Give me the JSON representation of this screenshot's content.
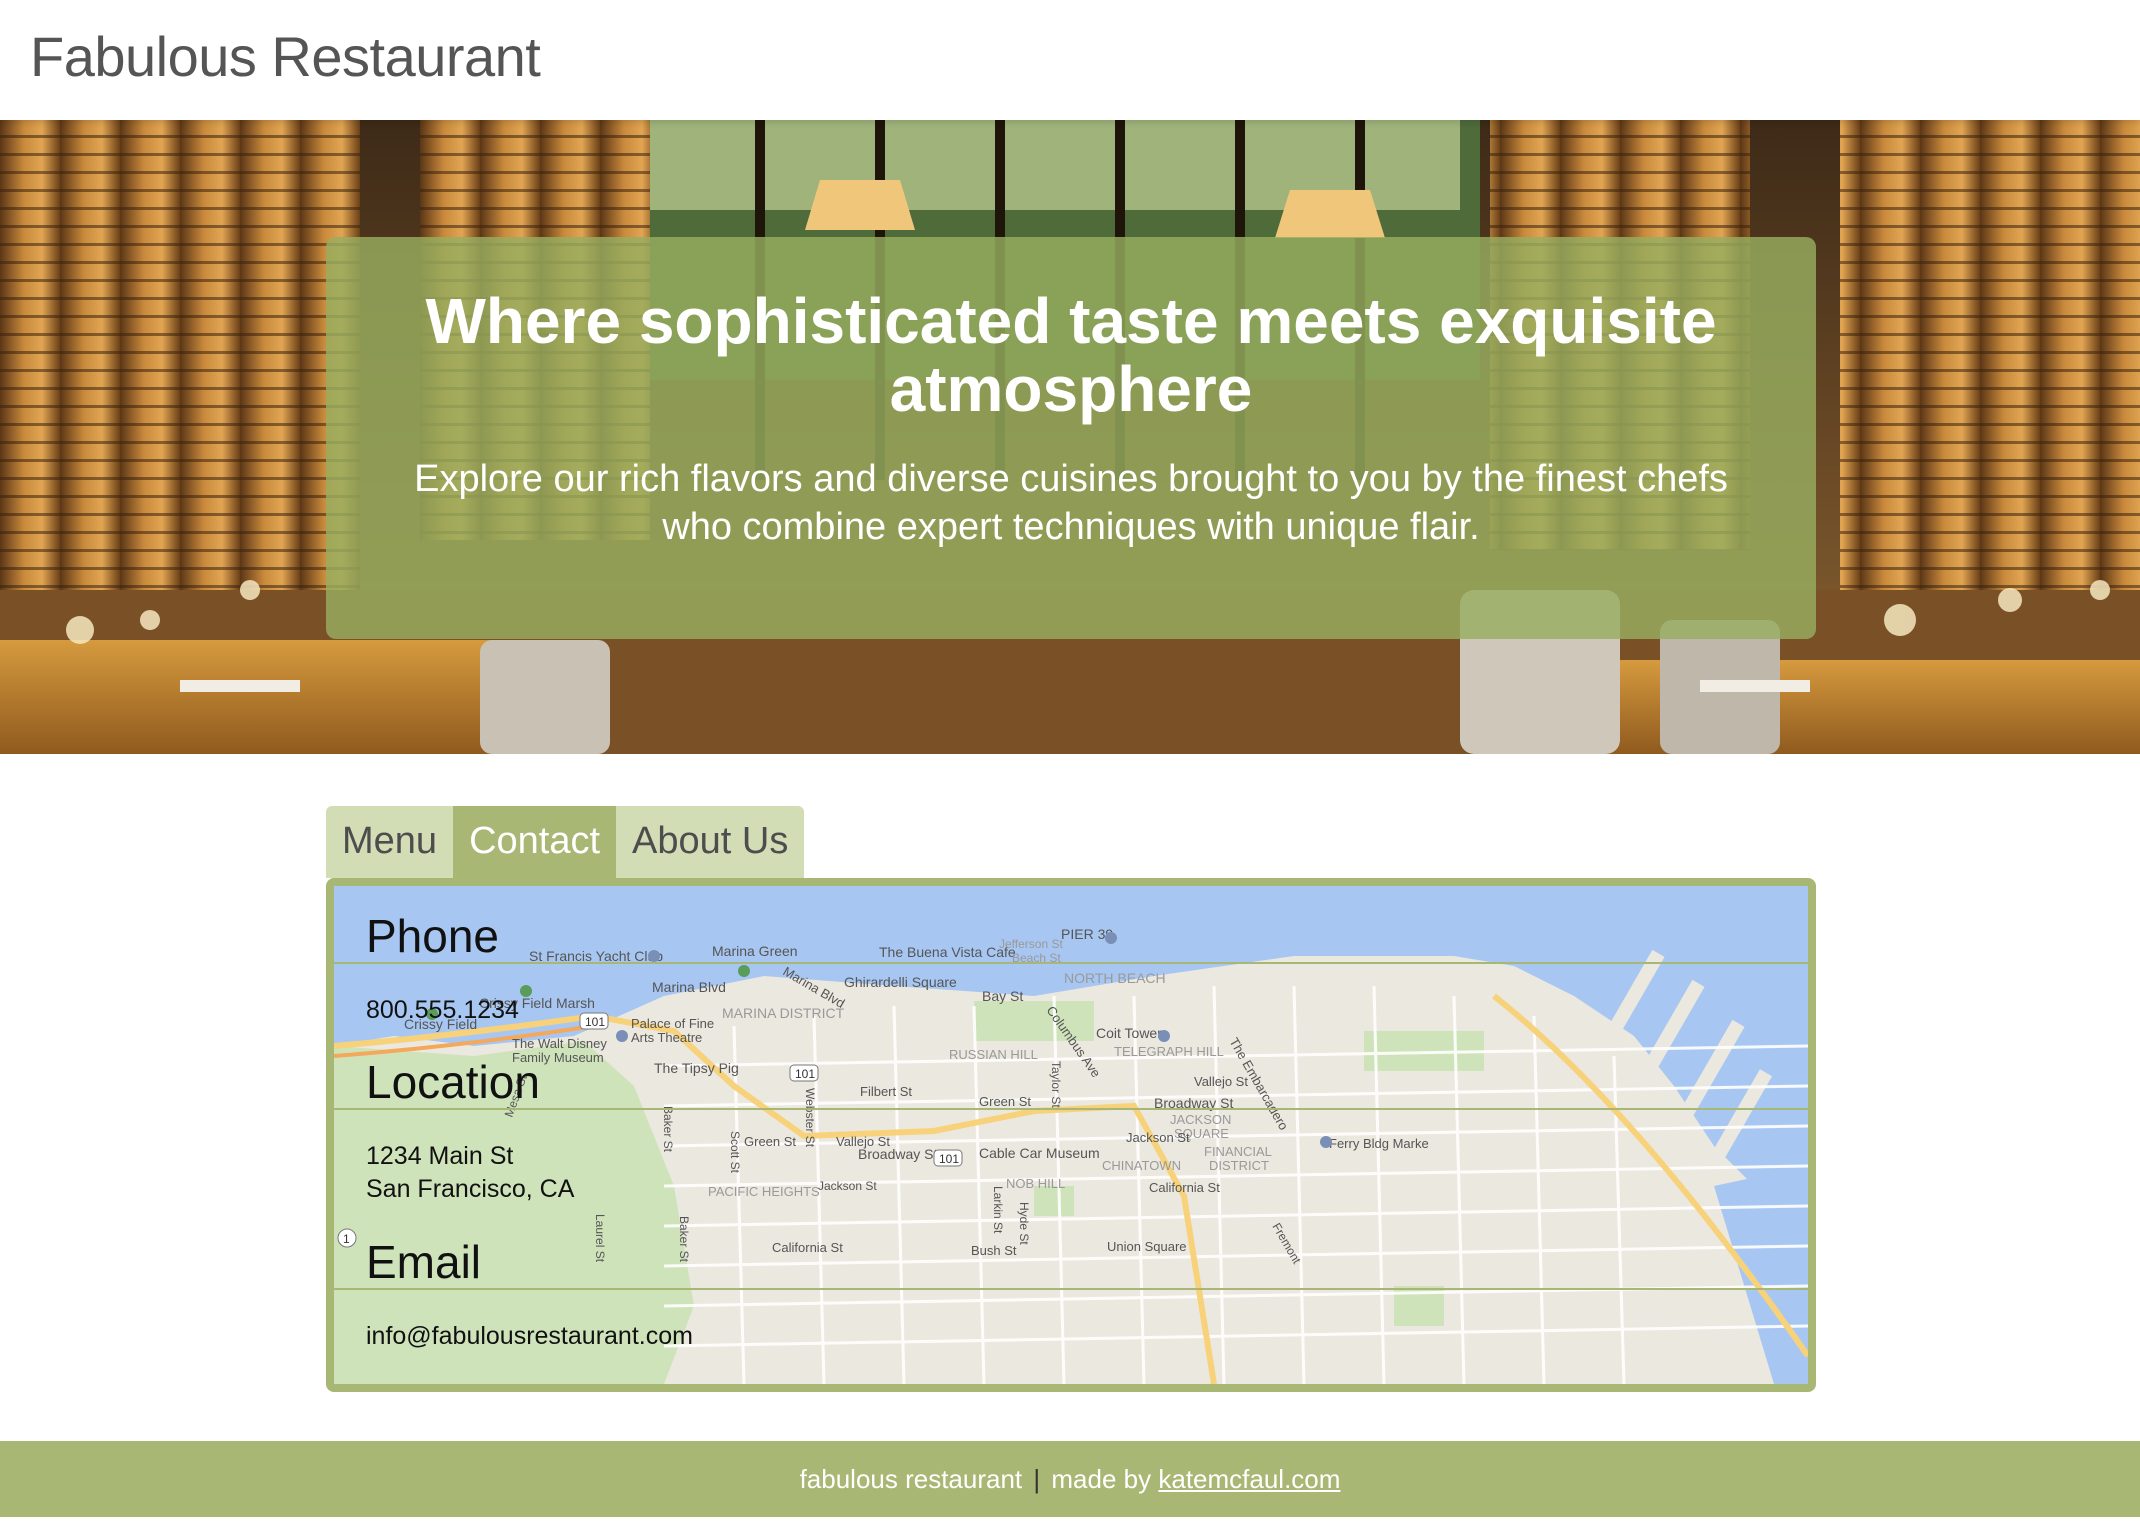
{
  "header": {
    "title": "Fabulous Restaurant"
  },
  "hero": {
    "heading": "Where sophisticated taste meets exquisite atmosphere",
    "text": "Explore our rich flavors and diverse cuisines brought to you by the finest chefs who combine expert techniques with unique flair."
  },
  "tabs": [
    {
      "label": "Menu",
      "active": false
    },
    {
      "label": "Contact",
      "active": true
    },
    {
      "label": "About Us",
      "active": false
    }
  ],
  "contact": {
    "phone_heading": "Phone",
    "phone": "800.555.1234",
    "location_heading": "Location",
    "address_line1": "1234 Main St",
    "address_line2": "San Francisco, CA",
    "email_heading": "Email",
    "email": "info@fabulousrestaurant.com"
  },
  "map_labels": {
    "yacht_club": "St Francis Yacht Club",
    "marina_green": "Marina Green",
    "buena_vista": "The Buena Vista Cafe",
    "pier39": "PIER 39",
    "jefferson": "Jefferson St",
    "beach_st": "Beach St",
    "marina_blvd": "Marina Blvd",
    "marina_blvd2": "Marina Blvd",
    "ghirardelli": "Ghirardelli Square",
    "north_beach": "NORTH BEACH",
    "bay_st": "Bay St",
    "crissy_marsh": "Crissy Field Marsh",
    "crissy_field": "Crissy Field",
    "palace": "Palace of Fine",
    "palace2": "Arts Theatre",
    "marina_district": "MARINA DISTRICT",
    "disney": "The Walt Disney",
    "disney2": "Family Museum",
    "coit": "Coit Tower",
    "telegraph": "TELEGRAPH HILL",
    "russian_hill": "RUSSIAN HILL",
    "tipsy_pig": "The Tipsy Pig",
    "columbus": "Columbus Ave",
    "embarcadero": "The Embarcadero",
    "filbert": "Filbert St",
    "green_st": "Green St",
    "green_st2": "Green St",
    "vallejo": "Vallejo St",
    "vallejo2": "Vallejo St",
    "broadway": "Broadway St",
    "broadway2": "Broadway St",
    "jackson_sq": "JACKSON",
    "jackson_sq2": "SQUARE",
    "jackson_st": "Jackson St",
    "jackson_st2": "Jackson St",
    "ferry": "Ferry Bldg Marke",
    "cable_car": "Cable Car Museum",
    "financial": "FINANCIAL",
    "financial2": "DISTRICT",
    "chinatown": "CHINATOWN",
    "pacific_heights": "PACIFIC HEIGHTS",
    "nob_hill": "NOB HILL",
    "california": "California St",
    "california2": "California St",
    "union_sq": "Union Square",
    "bush": "Bush St",
    "fremont": "Fremont",
    "taylor": "Taylor St",
    "webster": "Webster St",
    "baker": "Baker St",
    "baker2": "Baker St",
    "scott": "Scott St",
    "laurel": "Laurel St",
    "hyde": "Hyde St",
    "larkin": "Larkin St",
    "mesa": "Mesa St",
    "hwy101": "101",
    "hwy1": "1"
  },
  "footer": {
    "text": "fabulous restaurant",
    "separator": "|",
    "made_by": "made by",
    "link": "katemcfaul.com"
  },
  "colors": {
    "accent": "#a8b773",
    "tab_inactive": "#d2dcb5",
    "hero_overlay": "#97ad5f"
  }
}
